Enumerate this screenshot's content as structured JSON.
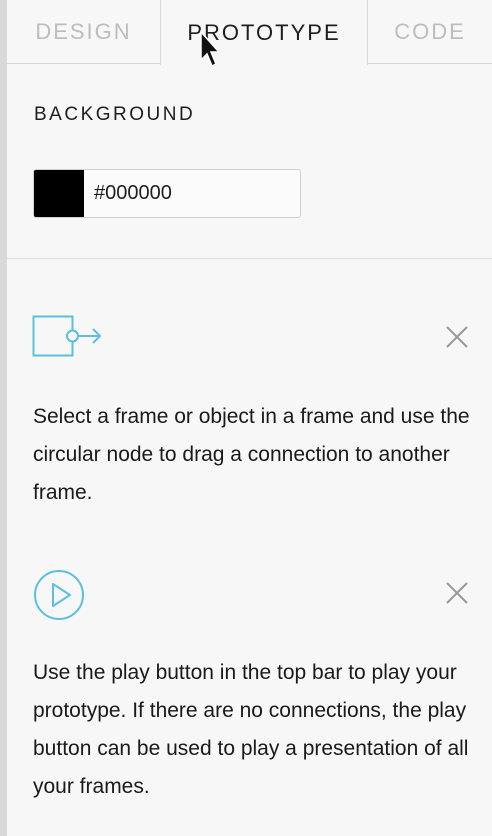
{
  "tabs": {
    "design": "DESIGN",
    "prototype": "PROTOTYPE",
    "code": "CODE",
    "active": "prototype"
  },
  "background": {
    "title": "BACKGROUND",
    "swatch_color": "#000000",
    "hex_value": "#000000"
  },
  "tips": [
    {
      "icon": "frame-connection-icon",
      "text": "Select a frame or object in a frame and use the circular node to drag a connection to another frame."
    },
    {
      "icon": "play-icon",
      "text": "Use the play button in the top bar to play your prototype. If there are no connections, the play button can be used to play a presentation of all your frames."
    }
  ],
  "colors": {
    "accent": "#5bc0de",
    "muted_text": "#bdbdbd",
    "text": "#1e1e1e"
  }
}
